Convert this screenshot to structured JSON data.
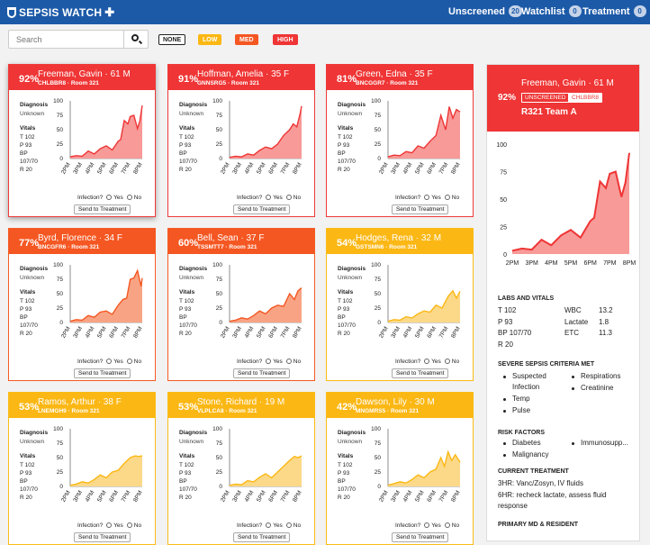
{
  "app": {
    "title": "SEPSIS WATCH",
    "nav": [
      {
        "label": "Unscreened",
        "count": "20"
      },
      {
        "label": "Watchlist",
        "count": "0"
      },
      {
        "label": "Treatment",
        "count": "0"
      }
    ]
  },
  "search": {
    "placeholder": "Search",
    "value": ""
  },
  "filters": [
    {
      "label": "NONE",
      "bg": "#ffffff",
      "fg": "#222222",
      "border": "#222222"
    },
    {
      "label": "LOW",
      "bg": "#fbb714",
      "fg": "#ffffff",
      "border": "#fbb714"
    },
    {
      "label": "MED",
      "bg": "#f55722",
      "fg": "#ffffff",
      "border": "#f55722"
    },
    {
      "label": "HIGH",
      "bg": "#ef3535",
      "fg": "#ffffff",
      "border": "#ef3535"
    }
  ],
  "colors": {
    "high": "#ef3535",
    "high_fill": "#f79a98",
    "med": "#f55722",
    "med_fill": "#f8a484",
    "low": "#fbb714",
    "low_fill": "#fcd989",
    "brand": "#1c5aa8"
  },
  "card_common": {
    "diagnosis_label": "Diagnosis",
    "diagnosis_value": "Unknown",
    "vitals_label": "Vitals",
    "t": "T   102",
    "p": "P   93",
    "bp_label": "BP",
    "bp": "107/70",
    "r": "R   20",
    "infection_label": "Infection?",
    "yes": "Yes",
    "no": "No",
    "send_label": "Send to Treatment",
    "x_ticks": [
      "2PM",
      "3PM",
      "4PM",
      "5PM",
      "6PM",
      "7PM",
      "8PM"
    ],
    "y_ticks": [
      "100",
      "75",
      "50",
      "25",
      "0"
    ]
  },
  "cards": [
    {
      "pct": "92%",
      "name": "Freeman, Gavin · 61 M",
      "id": "CHLBBR8 · Room 321",
      "level": "r",
      "selected": true
    },
    {
      "pct": "91%",
      "name": "Hoffman, Amelia · 35 F",
      "id": "GNNSRG5 · Room 321",
      "level": "r",
      "selected": false
    },
    {
      "pct": "81%",
      "name": "Green, Edna · 35 F",
      "id": "BNCGGR7 · Room 321",
      "level": "r",
      "selected": false
    },
    {
      "pct": "77%",
      "name": "Byrd, Florence · 34 F",
      "id": "BNCGFR6 · Room 321",
      "level": "o",
      "selected": false
    },
    {
      "pct": "60%",
      "name": "Bell, Sean · 37 F",
      "id": "TSSMTT7 · Room 321",
      "level": "o",
      "selected": false
    },
    {
      "pct": "54%",
      "name": "Hodges, Rena · 32 M",
      "id": "GSTSMN6 · Room 321",
      "level": "y",
      "selected": false
    },
    {
      "pct": "53%",
      "name": "Ramos, Arthur · 38 F",
      "id": "LNEMGH9 · Room 321",
      "level": "y",
      "selected": false
    },
    {
      "pct": "53%",
      "name": "Stone, Richard · 19 M",
      "id": "VLPLCA8 · Room 321",
      "level": "y",
      "selected": false
    },
    {
      "pct": "42%",
      "name": "Dawson, Lily · 30 M",
      "id": "MNGMRS5 · Room 321",
      "level": "y",
      "selected": false
    }
  ],
  "chart_data": [
    {
      "type": "area",
      "title": "Freeman, Gavin",
      "x": [
        "2PM",
        "3PM",
        "4PM",
        "5PM",
        "6PM",
        "7PM",
        "8PM"
      ],
      "ylim": [
        0,
        100
      ],
      "series": [
        {
          "x": [
            0,
            0.5,
            1,
            1.5,
            2,
            2.5,
            3,
            3.5,
            4,
            4.2,
            4.5,
            4.8,
            5,
            5.3,
            5.6,
            5.8,
            6
          ],
          "values": [
            3,
            5,
            4,
            13,
            8,
            17,
            22,
            15,
            30,
            33,
            66,
            60,
            73,
            75,
            52,
            65,
            92
          ]
        }
      ]
    },
    {
      "type": "area",
      "title": "Hoffman, Amelia",
      "x": [
        "2PM",
        "3PM",
        "4PM",
        "5PM",
        "6PM",
        "7PM",
        "8PM"
      ],
      "ylim": [
        0,
        100
      ],
      "series": [
        {
          "x": [
            0,
            0.5,
            1,
            1.5,
            2,
            2.5,
            3,
            3.5,
            4,
            4.5,
            5,
            5.3,
            5.6,
            5.9,
            6
          ],
          "values": [
            2,
            4,
            3,
            8,
            6,
            14,
            20,
            17,
            25,
            40,
            50,
            60,
            55,
            80,
            91
          ]
        }
      ]
    },
    {
      "type": "area",
      "title": "Green, Edna",
      "x": [
        "2PM",
        "3PM",
        "4PM",
        "5PM",
        "6PM",
        "7PM",
        "8PM"
      ],
      "ylim": [
        0,
        100
      ],
      "series": [
        {
          "x": [
            0,
            0.5,
            1,
            1.5,
            2,
            2.5,
            3,
            3.5,
            4,
            4.4,
            4.8,
            5.1,
            5.4,
            5.7,
            6
          ],
          "values": [
            3,
            6,
            5,
            12,
            10,
            22,
            18,
            30,
            40,
            75,
            50,
            90,
            70,
            85,
            81
          ]
        }
      ]
    },
    {
      "type": "area",
      "title": "Byrd, Florence",
      "x": [
        "2PM",
        "3PM",
        "4PM",
        "5PM",
        "6PM",
        "7PM",
        "8PM"
      ],
      "ylim": [
        0,
        100
      ],
      "series": [
        {
          "x": [
            0,
            0.5,
            1,
            1.5,
            2,
            2.5,
            3,
            3.5,
            4,
            4.4,
            4.7,
            5,
            5.3,
            5.6,
            5.9,
            6
          ],
          "values": [
            2,
            5,
            4,
            12,
            9,
            18,
            20,
            14,
            30,
            40,
            42,
            75,
            77,
            90,
            63,
            77
          ]
        }
      ]
    },
    {
      "type": "area",
      "title": "Bell, Sean",
      "x": [
        "2PM",
        "3PM",
        "4PM",
        "5PM",
        "6PM",
        "7PM",
        "8PM"
      ],
      "ylim": [
        0,
        100
      ],
      "series": [
        {
          "x": [
            0,
            0.5,
            1,
            1.5,
            2,
            2.5,
            3,
            3.5,
            4,
            4.5,
            5,
            5.4,
            5.7,
            6
          ],
          "values": [
            2,
            4,
            8,
            6,
            12,
            20,
            15,
            25,
            30,
            28,
            50,
            40,
            55,
            60
          ]
        }
      ]
    },
    {
      "type": "area",
      "title": "Hodges, Rena",
      "x": [
        "2PM",
        "3PM",
        "4PM",
        "5PM",
        "6PM",
        "7PM",
        "8PM"
      ],
      "ylim": [
        0,
        100
      ],
      "series": [
        {
          "x": [
            0,
            0.5,
            1,
            1.5,
            2,
            2.5,
            3,
            3.5,
            4,
            4.5,
            5,
            5.4,
            5.7,
            6
          ],
          "values": [
            2,
            5,
            4,
            10,
            8,
            15,
            20,
            18,
            30,
            25,
            45,
            55,
            42,
            54
          ]
        }
      ]
    },
    {
      "type": "area",
      "title": "Ramos, Arthur",
      "x": [
        "2PM",
        "3PM",
        "4PM",
        "5PM",
        "6PM",
        "7PM",
        "8PM"
      ],
      "ylim": [
        0,
        100
      ],
      "series": [
        {
          "x": [
            0,
            0.5,
            1,
            1.5,
            2,
            2.5,
            3,
            3.5,
            4,
            4.5,
            5,
            5.4,
            5.7,
            6
          ],
          "values": [
            2,
            4,
            8,
            6,
            12,
            20,
            15,
            25,
            28,
            40,
            50,
            53,
            52,
            53
          ]
        }
      ]
    },
    {
      "type": "area",
      "title": "Stone, Richard",
      "x": [
        "2PM",
        "3PM",
        "4PM",
        "5PM",
        "6PM",
        "7PM",
        "8PM"
      ],
      "ylim": [
        0,
        100
      ],
      "series": [
        {
          "x": [
            0,
            0.5,
            1,
            1.5,
            2,
            2.5,
            3,
            3.5,
            4,
            4.5,
            5,
            5.4,
            5.7,
            6
          ],
          "values": [
            2,
            4,
            3,
            10,
            8,
            16,
            22,
            15,
            25,
            35,
            45,
            52,
            50,
            53
          ]
        }
      ]
    },
    {
      "type": "area",
      "title": "Dawson, Lily",
      "x": [
        "2PM",
        "3PM",
        "4PM",
        "5PM",
        "6PM",
        "7PM",
        "8PM"
      ],
      "ylim": [
        0,
        100
      ],
      "series": [
        {
          "x": [
            0,
            0.5,
            1,
            1.5,
            2,
            2.5,
            3,
            3.5,
            4,
            4.4,
            4.7,
            5,
            5.3,
            5.6,
            6
          ],
          "values": [
            2,
            5,
            8,
            6,
            12,
            20,
            15,
            25,
            30,
            50,
            35,
            60,
            45,
            55,
            42
          ]
        }
      ]
    },
    {
      "type": "area",
      "title": "Freeman, Gavin",
      "x": [
        "2PM",
        "3PM",
        "4PM",
        "5PM",
        "6PM",
        "7PM",
        "8PM"
      ],
      "y_ticks": [
        "100",
        "75",
        "50",
        "25",
        "0"
      ],
      "ylim": [
        0,
        100
      ],
      "series": [
        {
          "x": [
            0,
            0.5,
            1,
            1.5,
            2,
            2.5,
            3,
            3.5,
            4,
            4.2,
            4.5,
            4.8,
            5,
            5.3,
            5.6,
            5.8,
            6
          ],
          "values": [
            3,
            5,
            4,
            13,
            8,
            17,
            22,
            15,
            30,
            33,
            66,
            60,
            73,
            75,
            52,
            65,
            92
          ]
        }
      ]
    }
  ],
  "detail": {
    "name": "Freeman, Gavin · 61 M",
    "pct": "92%",
    "badge_status": "UNSCREENED",
    "badge_id": "CHLBBR8",
    "room": "R321 Team A",
    "labs_title": "LABS AND VITALS",
    "labs_left": [
      "T   102",
      "P   93",
      "BP  107/70",
      "R   20"
    ],
    "labs_mid": [
      "WBC",
      "Lactate",
      "ETC"
    ],
    "labs_right": [
      "13.2",
      "1.8",
      "11.3"
    ],
    "criteria_title": "SEVERE SEPSIS CRITERIA MET",
    "criteria_left": [
      "Suspected",
      "Infection",
      "Temp",
      "Pulse"
    ],
    "criteria_right": [
      "Respirations",
      "Creatinine"
    ],
    "risk_title": "RISK FACTORS",
    "risk_left": [
      "Diabetes",
      "Malignancy"
    ],
    "risk_right": [
      "Immunosupp..."
    ],
    "treatment_title": "CURRENT TREATMENT",
    "treatment_lines": [
      "3HR: Vanc/Zosyn, IV fluids",
      "6HR: recheck lactate, assess fluid",
      "response"
    ],
    "md_title": "PRIMARY MD & RESIDENT"
  }
}
